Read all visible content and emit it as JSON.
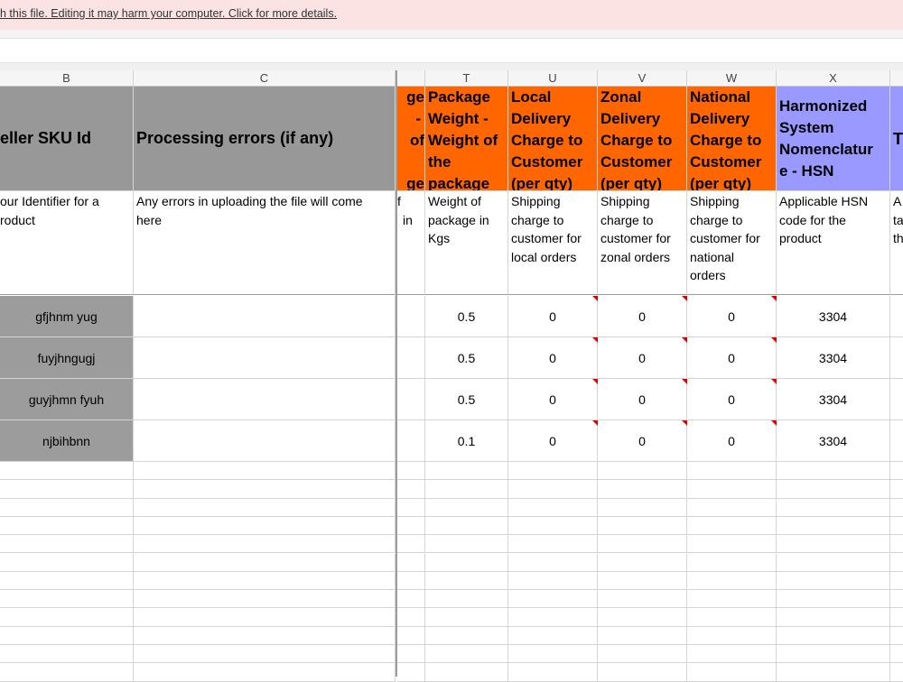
{
  "banner": {
    "text": "h this file. Editing it may harm your computer. Click for more details."
  },
  "columns": [
    "B",
    "C",
    "T",
    "U",
    "V",
    "W",
    "X"
  ],
  "headers": {
    "B": "eller SKU Id",
    "C": "Processing errors (if any)",
    "S_partial": [
      "ge",
      "-",
      "of",
      "",
      "ge"
    ],
    "T": [
      "Package",
      "Weight -",
      "Weight of",
      "the",
      "package"
    ],
    "U": [
      "Local",
      "Delivery",
      "Charge to",
      "Customer",
      "(per qty)"
    ],
    "V": [
      "Zonal",
      "Delivery",
      "Charge to",
      "Customer",
      "(per qty)"
    ],
    "W": [
      "National",
      "Delivery",
      "Charge to",
      "Customer",
      "(per qty)"
    ],
    "X": [
      "Harmonized",
      "System",
      "Nomenclatur",
      "e - HSN"
    ],
    "Y_partial": "T"
  },
  "descriptions": {
    "B": [
      "our Identifier for a",
      "roduct"
    ],
    "C": [
      "Any errors in uploading the file will come",
      "here"
    ],
    "S_partial": [
      "f",
      "in"
    ],
    "T": [
      "Weight of",
      "package in",
      "Kgs"
    ],
    "U": [
      "Shipping",
      "charge to",
      "customer for",
      "local orders"
    ],
    "V": [
      "Shipping",
      "charge to",
      "customer for",
      "zonal orders"
    ],
    "W": [
      "Shipping",
      "charge to",
      "customer for",
      "national",
      "orders"
    ],
    "X": [
      "Applicable HSN",
      "code for the",
      "product"
    ],
    "Y_partial": [
      "A",
      "ta",
      "th"
    ]
  },
  "rows": [
    {
      "sku": "gfjhnm yug",
      "errors": "",
      "weight": "0.5",
      "local": "0",
      "zonal": "0",
      "national": "0",
      "hsn": "3304"
    },
    {
      "sku": "fuyjhngugj",
      "errors": "",
      "weight": "0.5",
      "local": "0",
      "zonal": "0",
      "national": "0",
      "hsn": "3304"
    },
    {
      "sku": "guyjhmn fyuh",
      "errors": "",
      "weight": "0.5",
      "local": "0",
      "zonal": "0",
      "national": "0",
      "hsn": "3304"
    },
    {
      "sku": "njbihbnn",
      "errors": "",
      "weight": "0.1",
      "local": "0",
      "zonal": "0",
      "national": "0",
      "hsn": "3304"
    }
  ],
  "colors": {
    "grey_header": "#989898",
    "orange_header": "#ff6600",
    "purple_header": "#9999ff",
    "comment_marker": "#e00000",
    "banner": "#fbe3e4"
  }
}
